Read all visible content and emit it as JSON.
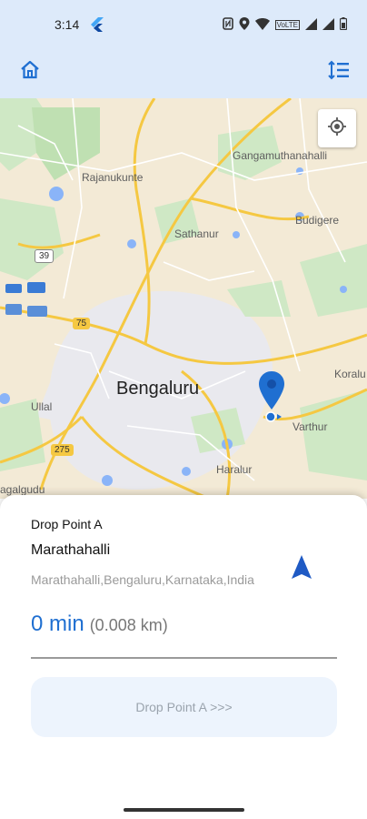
{
  "status_bar": {
    "time": "3:14",
    "icons": [
      "nfc-icon",
      "location-icon",
      "wifi-icon",
      "volte-icon",
      "signal-icon",
      "battery-icon"
    ],
    "volte_text": "VoLTE"
  },
  "app_bar": {
    "home_icon": "home-icon",
    "sort_icon": "sort-icon",
    "accent_color": "#1f6fd1"
  },
  "map": {
    "labels": {
      "gangamuthanahalli": "Gangamuthanahalli",
      "rajanukunte": "Rajanukunte",
      "sathanur": "Sathanur",
      "budigere": "Budigere",
      "bengaluru": "Bengaluru",
      "ullal": "Ullal",
      "varthur": "Varthur",
      "haralur": "Haralur",
      "koralu": "Koralu",
      "agalgudu": "agalgudu"
    },
    "shields": {
      "r39": "39",
      "r75": "75",
      "r275": "275"
    }
  },
  "drop": {
    "label": "Drop Point A",
    "place": "Marathahalli",
    "address": "Marathahalli,Bengaluru,Karnataka,India",
    "eta_time": "0 min",
    "eta_distance": "(0.008 km)",
    "button_label": "Drop Point A >>>"
  }
}
